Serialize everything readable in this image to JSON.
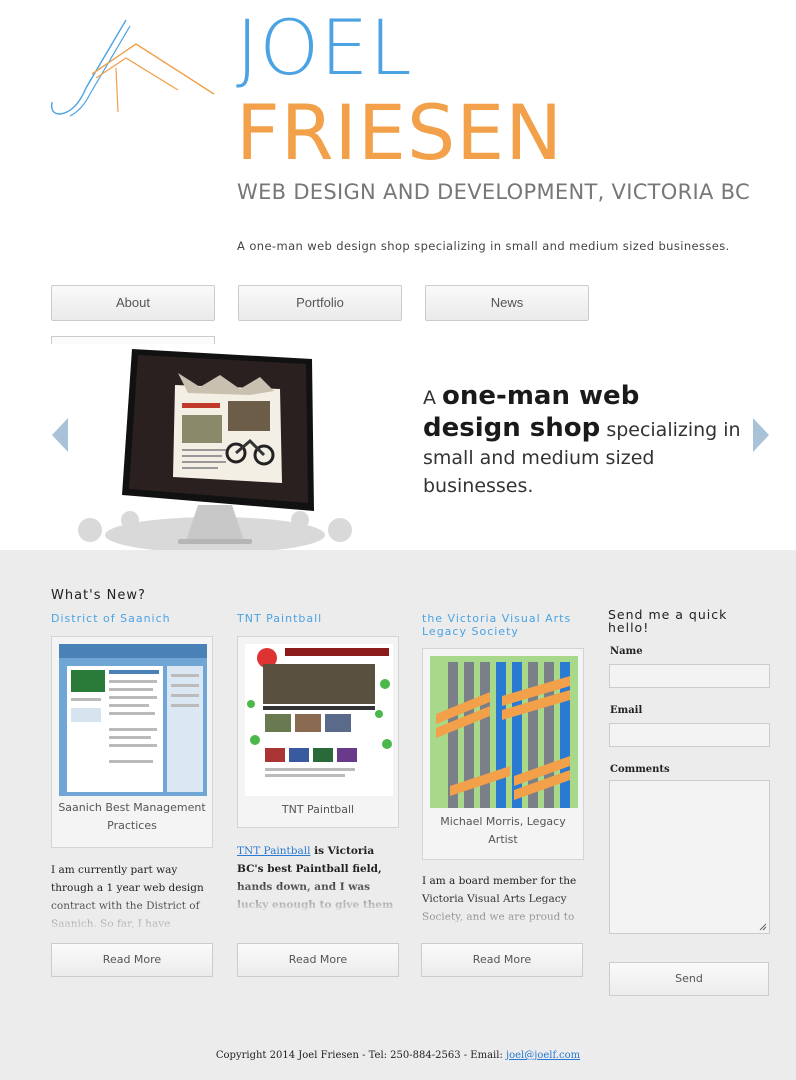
{
  "header": {
    "name_line1": "JOEL",
    "name_line2": "FRIESEN",
    "tagline": "WEB DESIGN AND DEVELOPMENT, VICTORIA BC",
    "subtagline": "A one-man web design shop specializing in small and medium sized businesses."
  },
  "nav": {
    "items": [
      {
        "label": "About"
      },
      {
        "label": "Portfolio"
      },
      {
        "label": "News"
      }
    ]
  },
  "slider": {
    "prefix": "A",
    "highlight": "one-man web design shop",
    "rest": "specializing in small and medium sized businesses."
  },
  "news": {
    "heading": "What's New?",
    "posts": [
      {
        "title": "District of Saanich",
        "caption": "Saanich Best Management Practices",
        "link_text": "",
        "excerpt": "I am currently part way through a 1 year web design contract with the District of Saanich. So far, I have",
        "read_more": "Read More"
      },
      {
        "title": "TNT Paintball",
        "caption": "TNT Paintball",
        "link_text": "TNT Paintball",
        "excerpt": " is Victoria BC's best Paintball field, hands down, and I was lucky enough to give them a new website.",
        "read_more": "Read More"
      },
      {
        "title": "the Victoria Visual Arts Legacy Society",
        "caption": "Michael Morris, Legacy Artist",
        "link_text": "",
        "excerpt": "I am a board member for the Victoria Visual Arts Legacy Society, and we are proud to",
        "read_more": "Read More"
      }
    ]
  },
  "contact": {
    "title": "Send me a quick hello!",
    "name_label": "Name",
    "email_label": "Email",
    "comments_label": "Comments",
    "send_label": "Send"
  },
  "footer": {
    "text": "Copyright 2014 Joel Friesen - Tel: 250-884-2563 - Email: ",
    "email": "joel@joelf.com"
  },
  "colors": {
    "blue": "#4ba3e3",
    "orange": "#f2a04a",
    "content_bg": "#ececec"
  }
}
